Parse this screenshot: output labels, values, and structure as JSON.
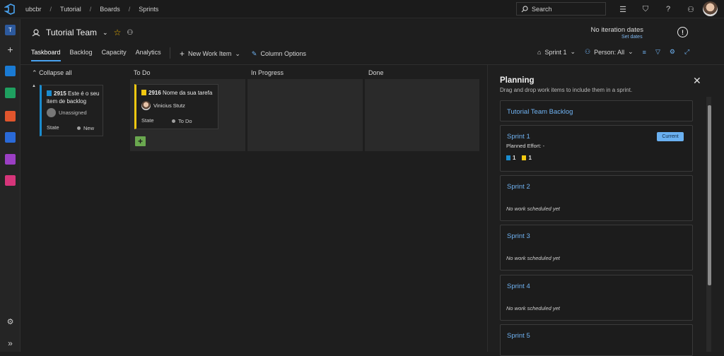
{
  "breadcrumbs": [
    "ubcbr",
    "Tutorial",
    "Boards",
    "Sprints"
  ],
  "search": {
    "placeholder": "Search"
  },
  "team": {
    "name": "Tutorial Team"
  },
  "iteration": {
    "status": "No iteration dates",
    "set_dates": "Set dates"
  },
  "tabs": [
    "Taskboard",
    "Backlog",
    "Capacity",
    "Analytics"
  ],
  "actions": {
    "new_work_item": "New Work Item",
    "column_options": "Column Options"
  },
  "toolbar": {
    "sprint": "Sprint 1",
    "person": "Person: All"
  },
  "board": {
    "collapse_all": "Collapse all",
    "columns": [
      "To Do",
      "In Progress",
      "Done"
    ],
    "backlog_card": {
      "id": "2915",
      "title": "Este é o seu item de backlog",
      "assignee": "Unassigned",
      "state_label": "State",
      "state": "New"
    },
    "task_card": {
      "id": "2916",
      "title": "Nome da sua tarefa",
      "assignee": "Vinicius Stutz",
      "state_label": "State",
      "state": "To Do"
    }
  },
  "planning": {
    "title": "Planning",
    "subtitle": "Drag and drop work items to include them in a sprint.",
    "backlog_label": "Tutorial Team Backlog",
    "sprint1": {
      "name": "Sprint 1",
      "badge": "Current",
      "effort": "Planned Effort: -",
      "count_a": "1",
      "count_b": "1"
    },
    "sprint2": {
      "name": "Sprint 2",
      "note": "No work scheduled yet"
    },
    "sprint3": {
      "name": "Sprint 3",
      "note": "No work scheduled yet"
    },
    "sprint4": {
      "name": "Sprint 4",
      "note": "No work scheduled yet"
    },
    "sprint5": {
      "name": "Sprint 5"
    }
  },
  "colors": {
    "accent": "#4aa3f0",
    "link": "#6fb2f2",
    "backlog_bar": "#1a8ccf",
    "task_bar": "#f2c811",
    "add": "#6aa84f"
  }
}
